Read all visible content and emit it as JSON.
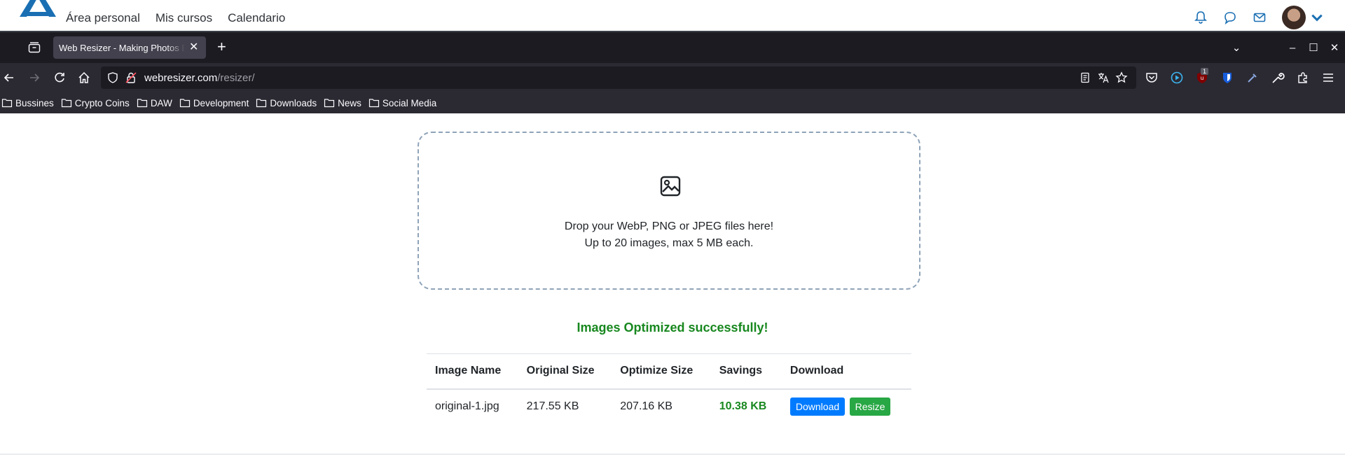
{
  "site": {
    "nav": [
      "Área personal",
      "Mis cursos",
      "Calendario"
    ],
    "icons": [
      "bell-icon",
      "chat-icon",
      "mail-icon",
      "avatar",
      "chevron-down-icon"
    ]
  },
  "browser": {
    "tab_title": "Web Resizer - Making Photos Better",
    "url_host": "webresizer.com",
    "url_path": "/resizer/",
    "bookmarks": [
      "Bussines",
      "Crypto Coins",
      "DAW",
      "Development",
      "Downloads",
      "News",
      "Social Media"
    ],
    "extension_badge": "1"
  },
  "dropzone": {
    "line1": "Drop your WebP, PNG or JPEG files here!",
    "line2": "Up to 20 images, max 5 MB each."
  },
  "result": {
    "message": "Images Optimized successfully!",
    "columns": [
      "Image Name",
      "Original Size",
      "Optimize Size",
      "Savings",
      "Download"
    ],
    "rows": [
      {
        "name": "original-1.jpg",
        "original": "217.55 KB",
        "optimized": "207.16 KB",
        "savings": "10.38 KB",
        "download_label": "Download",
        "resize_label": "Resize"
      }
    ]
  },
  "colors": {
    "accent_blue": "#007bff",
    "accent_green": "#28a745",
    "success_text": "#18881f",
    "browser_dark": "#1c1b22"
  }
}
